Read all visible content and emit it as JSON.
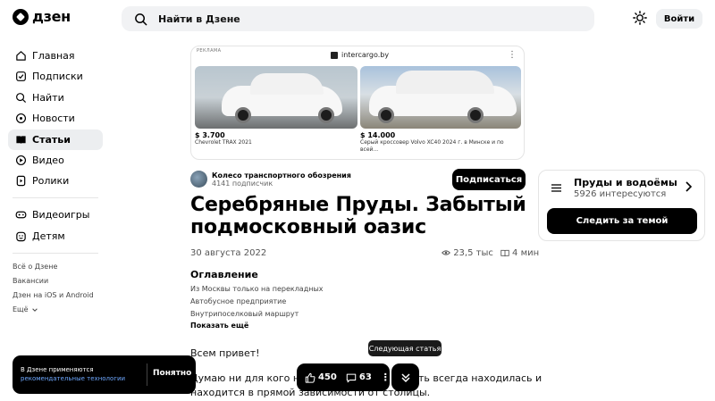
{
  "header": {
    "logo_text": "дзен",
    "search_placeholder": "Найти в Дзене",
    "login_label": "Войти"
  },
  "sidebar": {
    "items": [
      {
        "label": "Главная",
        "icon": "home-icon"
      },
      {
        "label": "Подписки",
        "icon": "subscriptions-icon"
      },
      {
        "label": "Найти",
        "icon": "search-icon"
      },
      {
        "label": "Новости",
        "icon": "news-icon"
      },
      {
        "label": "Статьи",
        "icon": "articles-icon",
        "active": true
      },
      {
        "label": "Видео",
        "icon": "video-icon"
      },
      {
        "label": "Ролики",
        "icon": "clips-icon"
      }
    ],
    "extra": [
      {
        "label": "Видеоигры",
        "icon": "gamepad-icon"
      },
      {
        "label": "Детям",
        "icon": "kids-icon"
      }
    ],
    "footer_links": [
      "Всё о Дзене",
      "Вакансии",
      "Дзен на iOS и Android",
      "Ещё"
    ]
  },
  "ad": {
    "label": "РЕКЛАМА",
    "source": "intercargo.by",
    "items": [
      {
        "price": "$ 3.700",
        "desc": "Chevrolet TRAX 2021"
      },
      {
        "price": "$ 14.000",
        "desc": "Серый кроссовер Volvo XC40 2024 г. в Минске и по всей..."
      }
    ]
  },
  "article": {
    "author_name": "Колесо транспортного обозрения",
    "author_subs": "4141 подписчик",
    "subscribe_label": "Подписаться",
    "title": "Серебряные Пруды. Забытый подмосковный оазис",
    "date": "30 августа 2022",
    "views": "23,5 тыс",
    "read_time": "4 мин",
    "toc_title": "Оглавление",
    "toc": [
      "Из Москвы только на перекладных",
      "Автобусное предприятие",
      "Внутрипоселковый маршрут"
    ],
    "toc_more": "Показать ещё",
    "greeting": "Всем привет!",
    "para_line1_a": "Думаю ни для кого не се",
    "para_line1_b": "ть всегда находилась и",
    "para_line2": "находится в прямой зависимости от столицы."
  },
  "topic": {
    "name": "Пруды и водоёмы",
    "count": "5926 интересуются",
    "follow_label": "Следить за темой"
  },
  "cookie": {
    "text": "В Дзене применяются",
    "link": "рекомендательные технологии",
    "button": "Понятно"
  },
  "reactions": {
    "likes": "450",
    "comments": "63",
    "next_tooltip": "Следующая статья"
  }
}
